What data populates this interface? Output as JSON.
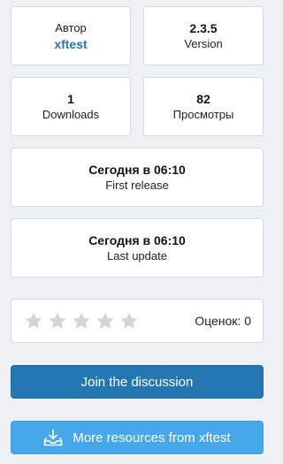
{
  "author": {
    "label": "Автор",
    "name": "xftest"
  },
  "version": {
    "value": "2.3.5",
    "label": "Version"
  },
  "downloads": {
    "value": "1",
    "label": "Downloads"
  },
  "views": {
    "value": "82",
    "label": "Просмотры"
  },
  "first_release": {
    "value": "Сегодня в 06:10",
    "label": "First release"
  },
  "last_update": {
    "value": "Сегодня в 06:10",
    "label": "Last update"
  },
  "rating": {
    "stars_total": 5,
    "stars_filled": 0,
    "count_text": "Оценок: 0",
    "star_color_empty": "#d2d4d8"
  },
  "buttons": {
    "join_label": "Join the discussion",
    "more_label": "More resources from xftest",
    "more_icon": "download-tray-icon"
  },
  "colors": {
    "link": "#2577b1",
    "primary_button": "#2577b1",
    "secondary_button": "#47a7eb"
  }
}
